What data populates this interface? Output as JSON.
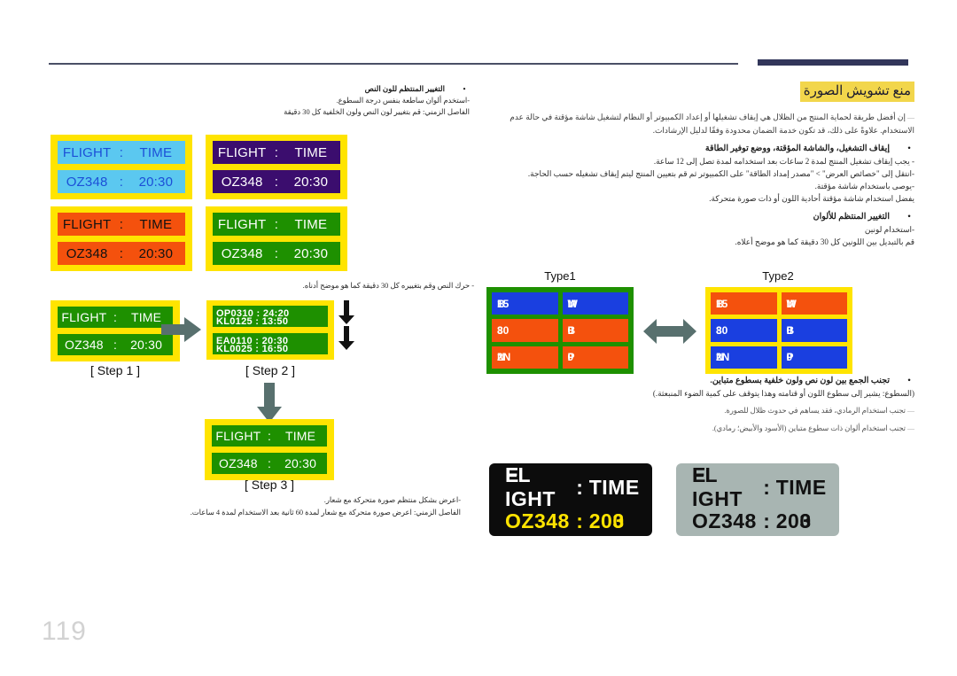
{
  "page": {
    "number": "119",
    "section_title": "منع تشويش الصورة"
  },
  "right_column": {
    "intro": "إن أفضل طريقة لحماية المنتج من الظلال هي إيقاف تشغيلها أو إعداد الكمبيوتر أو النظام لتشغيل شاشة مؤقتة في حالة عدم الاستخدام. علاوةً على ذلك، قد تكون خدمة الضمان محدودة وفقًا لدليل الإرشادات.",
    "bullet1": "إيقاف التشغيل، والشاشة المؤقتة، ووضع توفير الطاقة",
    "bullet1_lines": [
      "- يجب إيقاف تشغيل المنتج لمدة 2 ساعات بعد استخدامه لمدة تصل إلى 12 ساعة.",
      "-انتقل إلى \"خصائص العرض\" > \"مصدر إمداد الطاقة\" على الكمبيوتر ثم قم بتعيين المنتج ليتم إيقاف تشغيله حسب الحاجة.",
      "-يوصى باستخدام شاشة مؤقتة.",
      "يفضل استخدام شاشة مؤقتة أحادية اللون أو ذات صورة متحركة."
    ],
    "bullet2": "التغيير المنتظم للألوان",
    "bullet2_lines": [
      "-استخدام لونين",
      "قم بالتبديل بين اللونين كل 30 دقيقة كما هو موضح أعلاه."
    ],
    "bullet3": "تجنب الجمع بين لون نص ولون خلفية بسطوع متباين.",
    "bullet3_lines": [
      "(السطوع: يشير إلى سطوع اللون أو قتامته وهذا يتوقف على كمية الضوء المنبعثة.)",
      "تجنب استخدام الرمادي، فقد يساهم في حدوث ظلال للصورة.",
      "تجنب استخدام ألوان ذات سطوع متباين (الأسود والأبيض؛ رمادي)."
    ]
  },
  "left_column": {
    "bullet_top": "التغيير المنتظم للون النص",
    "top_lines": [
      "-استخدم ألوان ساطعة بنفس درجة السطوع.",
      "الفاصل الزمني: قم بتغيير لون النص ولون الخلفية كل 30 دقيقة"
    ],
    "mid_note": "- حرك النص وقم بتغييره كل 30 دقيقة كما هو موضح أدناه.",
    "bottom_lines": [
      "-اعرض بشكل منتظم صورة متحركة مع شعار.",
      "الفاصل الزمني: اعرض صورة متحركة مع شعار لمدة 60 ثانية بعد الاستخدام لمدة 4 ساعات."
    ]
  },
  "flight_panels": [
    {
      "id": "panel-cyan",
      "variant": "v-cyan",
      "header": {
        "left": "FLIGHT",
        "sep": ":",
        "right": "TIME"
      },
      "row": {
        "left": "OZ348",
        "sep": ":",
        "right": "20:30"
      },
      "colors": {
        "bg": "#5bc8f0",
        "text": "#1c4fd8",
        "border": "#ffe400"
      }
    },
    {
      "id": "panel-purple",
      "variant": "v-purple",
      "header": {
        "left": "FLIGHT",
        "sep": ":",
        "right": "TIME"
      },
      "row": {
        "left": "OZ348",
        "sep": ":",
        "right": "20:30"
      },
      "colors": {
        "bg": "#3b0d6e",
        "text": "#ffffff",
        "border": "#ffe400"
      }
    },
    {
      "id": "panel-orange",
      "variant": "v-orange",
      "header": {
        "left": "FLIGHT",
        "sep": ":",
        "right": "TIME"
      },
      "row": {
        "left": "OZ348",
        "sep": ":",
        "right": "20:30"
      },
      "colors": {
        "bg": "#f4510d",
        "text": "#121212",
        "border": "#ffe400"
      }
    },
    {
      "id": "panel-green",
      "variant": "v-green",
      "header": {
        "left": "FLIGHT",
        "sep": ":",
        "right": "TIME"
      },
      "row": {
        "left": "OZ348",
        "sep": ":",
        "right": "20:30"
      },
      "colors": {
        "bg": "#1e9000",
        "text": "#ffffff",
        "border": "#ffe400"
      }
    }
  ],
  "steps": {
    "step1": {
      "caption": "[ Step 1 ]",
      "header": {
        "left": "FLIGHT",
        "sep": ":",
        "right": "TIME"
      },
      "row": {
        "left": "OZ348",
        "sep": ":",
        "right": "20:30"
      }
    },
    "step2": {
      "caption": "[ Step 2 ]",
      "rows": [
        {
          "top": "OP0310  :  24:20",
          "bottom": "KL0125  :  13:50"
        },
        {
          "top": "EA0110  :  20:30",
          "bottom": "KL0025  :  16:50"
        }
      ]
    },
    "step3": {
      "caption": "[ Step 3 ]",
      "header": {
        "left": "FLIGHT",
        "sep": ":",
        "right": "TIME"
      },
      "row": {
        "left": "OZ348",
        "sep": ":",
        "right": "20:30"
      }
    }
  },
  "types": {
    "type1": {
      "label": "Type1",
      "border": "#1e9000",
      "cells": [
        {
          "glyph_a": "B",
          "glyph_b": "15",
          "bg": "#1a3fe0"
        },
        {
          "glyph_a": "M",
          "glyph_b": "W",
          "bg": "#1a3fe0"
        },
        {
          "glyph_a": "30",
          "glyph_b": "8",
          "bg": "#f4510d"
        },
        {
          "glyph_a": "0",
          "glyph_b": "B",
          "bg": "#f4510d"
        },
        {
          "glyph_a": "2N",
          "glyph_b": "N",
          "bg": "#f4510d"
        },
        {
          "glyph_a": "0",
          "glyph_b": "P",
          "bg": "#f4510d"
        }
      ]
    },
    "type2": {
      "label": "Type2",
      "border": "#ffe400",
      "cells": [
        {
          "glyph_a": "B",
          "glyph_b": "15",
          "bg": "#f4510d"
        },
        {
          "glyph_a": "M",
          "glyph_b": "W",
          "bg": "#f4510d"
        },
        {
          "glyph_a": "30",
          "glyph_b": "8",
          "bg": "#1a3fe0"
        },
        {
          "glyph_a": "0",
          "glyph_b": "B",
          "bg": "#1a3fe0"
        },
        {
          "glyph_a": "2N",
          "glyph_b": "N",
          "bg": "#1a3fe0"
        },
        {
          "glyph_a": "0",
          "glyph_b": "P",
          "bg": "#1a3fe0"
        }
      ]
    }
  },
  "boards": {
    "dark": {
      "header": {
        "a": "FL",
        "a2": "E",
        "rest": "IGHT",
        "sep": ":",
        "b": "TIME"
      },
      "row": {
        "a": "OZ348",
        "sep": ":",
        "b": "20",
        "b2": "3",
        "b3": "0"
      },
      "bg": "#0c0c0c",
      "header_color": "#ffffff",
      "row_color": "#ffe400"
    },
    "gray": {
      "header": {
        "a": "FL",
        "a2": "E",
        "rest": "IGHT",
        "sep": ":",
        "b": "TIME"
      },
      "row": {
        "a": "OZ348",
        "sep": ":",
        "b": "20",
        "b2": "3",
        "b3": "0"
      },
      "bg": "#a8b5b2",
      "header_color": "#111111",
      "row_color": "#111111"
    }
  },
  "icons": {
    "arrow_right": "arrow-right-icon",
    "arrow_down": "arrow-down-icon",
    "arrow_both": "arrow-left-right-icon"
  }
}
